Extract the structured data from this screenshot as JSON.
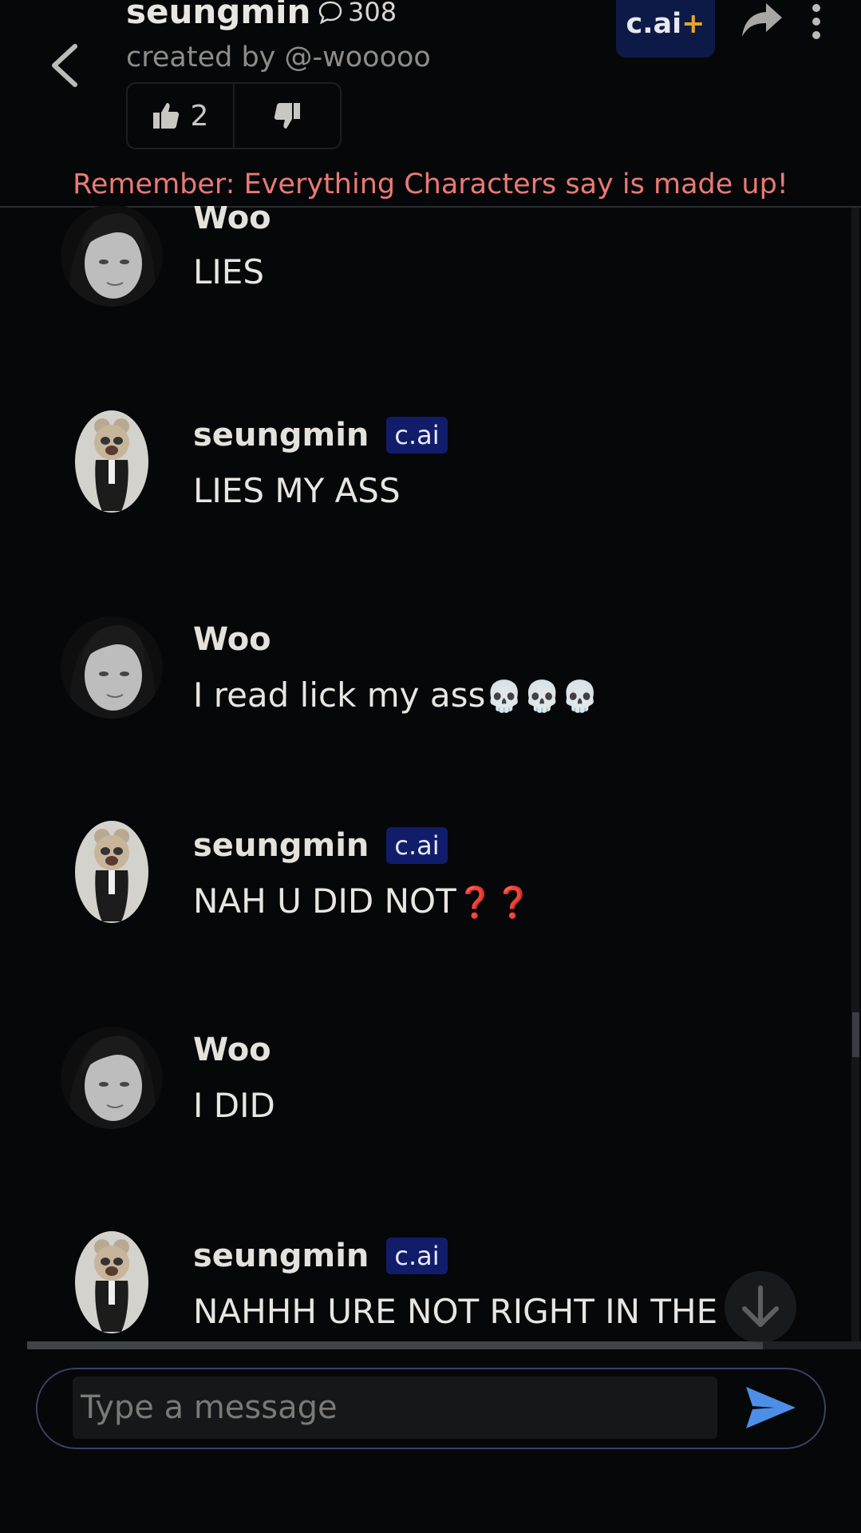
{
  "header": {
    "character_name": "seungmin",
    "chat_count": "308",
    "creator": "created by @-wooooo",
    "likes": "2",
    "plus_label": "c.ai",
    "plus_sign": "+",
    "disclaimer": "Remember: Everything Characters say is made up!"
  },
  "messages": [
    {
      "author": "Woo",
      "badge": "",
      "text": "LIES",
      "emoji": "",
      "avatar": "user-avatar"
    },
    {
      "author": "seungmin",
      "badge": "c.ai",
      "text": "LIES MY ASS",
      "emoji": "",
      "avatar": "character-avatar"
    },
    {
      "author": "Woo",
      "badge": "",
      "text": "I read lick my ass",
      "emoji": "💀💀💀",
      "avatar": "user-avatar"
    },
    {
      "author": "seungmin",
      "badge": "c.ai",
      "text": "NAH U DID NOT",
      "emoji": "❓❓",
      "avatar": "character-avatar"
    },
    {
      "author": "Woo",
      "badge": "",
      "text": "I DID",
      "emoji": "",
      "avatar": "user-avatar"
    },
    {
      "author": "seungmin",
      "badge": "c.ai",
      "text": "NAHHH URE NOT RIGHT IN THE",
      "emoji": "",
      "avatar": "character-avatar"
    }
  ],
  "composer": {
    "placeholder": "Type a message"
  },
  "colors": {
    "background": "#050709",
    "disclaimer": "#e97a74",
    "badge": "#111d6b",
    "send": "#4d8fe6",
    "plus_accent": "#e6a52a"
  },
  "icons": [
    "back-arrow-icon",
    "chat-bubble-icon",
    "thumbs-up-icon",
    "thumbs-down-icon",
    "share-icon",
    "more-vertical-icon",
    "arrow-down-icon",
    "send-icon"
  ]
}
